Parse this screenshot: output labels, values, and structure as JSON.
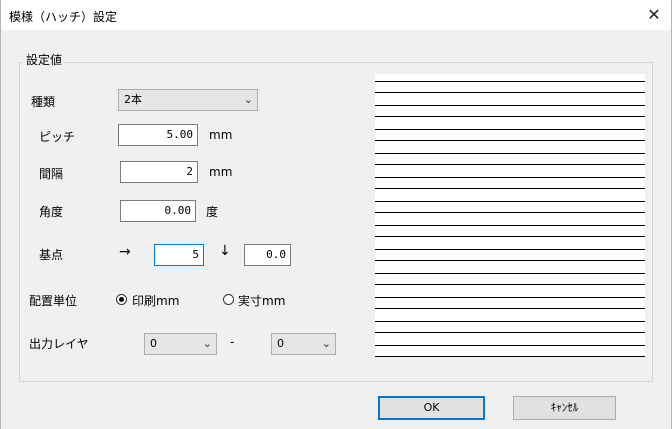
{
  "window": {
    "title": "模様（ハッチ）設定",
    "close_glyph": "✕"
  },
  "group": {
    "label": "設定値"
  },
  "kind": {
    "label": "種類",
    "value": "2本"
  },
  "pitch": {
    "label": "ピッチ",
    "value": "5.00",
    "unit": "mm"
  },
  "gap": {
    "label": "間隔",
    "value": "2",
    "unit": "mm"
  },
  "angle": {
    "label": "角度",
    "value": "0.00",
    "unit": "度"
  },
  "base": {
    "label": "基点",
    "arrow_right": "→",
    "x": "5",
    "arrow_down": "↓",
    "y": "0.0"
  },
  "placement": {
    "label": "配置単位",
    "options": [
      {
        "label": "印刷mm",
        "selected": true
      },
      {
        "label": "実寸mm",
        "selected": false
      }
    ]
  },
  "layer": {
    "label": "出力レイヤ",
    "from": "0",
    "separator": "-",
    "to": "0"
  },
  "preview": {
    "line_count": 24
  },
  "buttons": {
    "ok": "OK",
    "cancel": "ｷｬﾝｾﾙ"
  },
  "icons": {
    "dropdown": "chevron-down-icon",
    "close": "close-icon"
  }
}
